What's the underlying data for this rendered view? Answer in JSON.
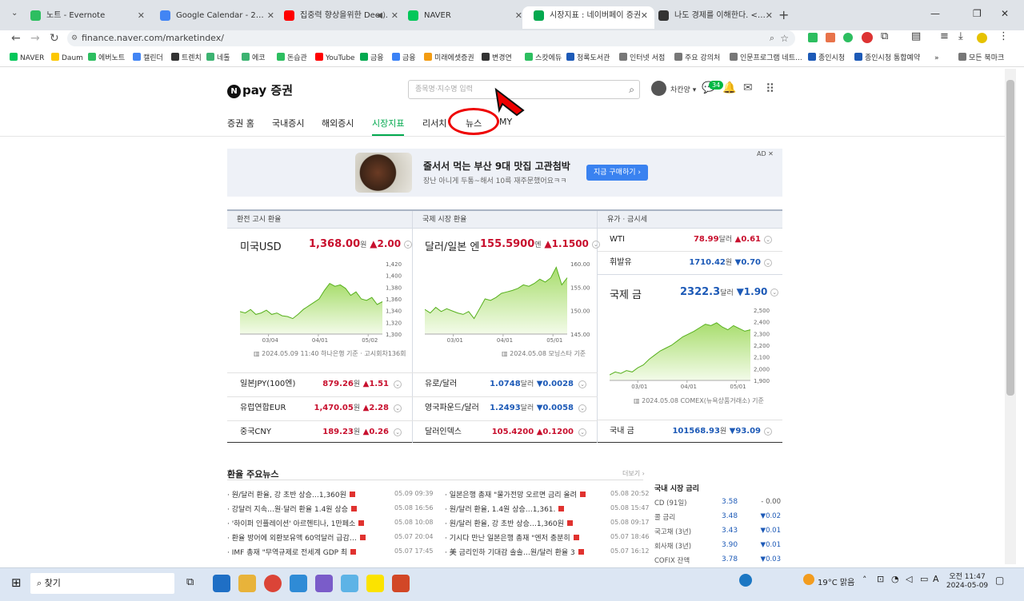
{
  "tabs": [
    {
      "label": "노트 - Evernote",
      "color": "#2dbe60"
    },
    {
      "label": "Google Calendar - 2024년 5월",
      "color": "#4285f4"
    },
    {
      "label": "집중력 향상을위한 Deep F",
      "color": "#ff0000"
    },
    {
      "label": "NAVER",
      "color": "#03c75a"
    },
    {
      "label": "시장지표 : 네이버페이 증권",
      "color": "#03a94f"
    },
    {
      "label": "나도 경제를 이해한다. <돈습관",
      "color": "#333333"
    }
  ],
  "address": {
    "url": "finance.naver.com/marketindex/"
  },
  "bookmarks": [
    "NAVER",
    "Daum",
    "에버노트",
    "캘린더",
    "트렌치",
    "네톨",
    "에코",
    "돈습관",
    "YouTube",
    "금융",
    "금융",
    "미래에셋증권",
    "변경연",
    "스캇에듀",
    "청록도서관",
    "인터넷 서점",
    "주요 강의처",
    "인문프로그램 네트...",
    "종인시청",
    "종인시청 통합예약",
    "모든 북마크"
  ],
  "header": {
    "logo_n": "N",
    "logo_text": "pay 증권",
    "search_placeholder": "종목명·지수명 입력",
    "user_name": "차칸양",
    "badge": "34"
  },
  "gnb": [
    "증권 홈",
    "국내증시",
    "해외증시",
    "시장지표",
    "리서치",
    "뉴스",
    "MY"
  ],
  "ad": {
    "title": "줄서서 먹는 부산 9대 맛집 고관첨박",
    "subtitle": "장난 아니게 두통~해서 10륵 재주문했어요ㅋㅋ",
    "button": "지금 구매하기 ›",
    "tag": "AD ✕"
  },
  "market": {
    "headers": [
      "환전 고시 환율",
      "국제 시장 환율",
      "유가 · 금시세"
    ],
    "usd": {
      "name": "미국USD",
      "value": "1,368.00",
      "unit": "원",
      "change": "▲2.00",
      "yticks": [
        "1,420",
        "1,400",
        "1,380",
        "1,360",
        "1,340",
        "1,320",
        "1,300"
      ],
      "xticks": [
        "03/04",
        "04/01",
        "05/02"
      ],
      "source": "2024.05.09 11:40 하나은행 기준 · 고시회차136회"
    },
    "jpy": {
      "name": "달러/일본 엔",
      "value": "155.5900",
      "unit": "엔",
      "change": "▲1.1500",
      "yticks": [
        "160.00",
        "155.00",
        "150.00",
        "145.00"
      ],
      "xticks": [
        "03/01",
        "04/01",
        "05/01"
      ],
      "source": "2024.05.08 모닝스타 기준"
    },
    "wti": {
      "name": "WTI",
      "value": "78.99",
      "unit": "달러",
      "change": "▲0.61"
    },
    "gasoline": {
      "name": "휘발유",
      "value": "1710.42",
      "unit": "원",
      "change": "▼0.70"
    },
    "gold": {
      "name": "국제 금",
      "value": "2322.3",
      "unit": "달러",
      "change": "▼1.90",
      "yticks": [
        "2,500",
        "2,400",
        "2,300",
        "2,200",
        "2,100",
        "2,000",
        "1,900"
      ],
      "xticks": [
        "03/01",
        "04/01",
        "05/01"
      ],
      "source": "2024.05.08 COMEX(뉴욕상품거래소) 기준"
    },
    "rows_left": [
      {
        "name": "일본JPY(100엔)",
        "value": "879.26",
        "unit": "원",
        "change": "▲1.51",
        "dir": "up"
      },
      {
        "name": "유럽연합EUR",
        "value": "1,470.05",
        "unit": "원",
        "change": "▲2.28",
        "dir": "up"
      },
      {
        "name": "중국CNY",
        "value": "189.23",
        "unit": "원",
        "change": "▲0.26",
        "dir": "up"
      }
    ],
    "rows_mid": [
      {
        "name": "유로/달러",
        "value": "1.0748",
        "unit": "달러",
        "change": "▼0.0028",
        "dir": "dn"
      },
      {
        "name": "영국파운드/달러",
        "value": "1.2493",
        "unit": "달러",
        "change": "▼0.0058",
        "dir": "dn"
      },
      {
        "name": "달러인덱스",
        "value": "105.4200",
        "unit": "",
        "change": "▲0.1200",
        "dir": "up"
      }
    ],
    "domestic_gold": {
      "name": "국내 금",
      "value": "101568.93",
      "unit": "원",
      "change": "▼93.09"
    }
  },
  "news": {
    "title": "환율 주요뉴스",
    "more": "더보기 ›",
    "left": [
      {
        "t": "원/달러 환율, 강 초반 상승…1,360원",
        "d": "05.09 09:39"
      },
      {
        "t": "강달러 지속…원·달러 환율 1.4원 상승",
        "d": "05.08 16:56"
      },
      {
        "t": "'하이퍼 인플레이션' 아르헨티나, 1만페소",
        "d": "05.08 10:08"
      },
      {
        "t": "환율 방어에 외환보유액 60억달러 급감…",
        "d": "05.07 20:04"
      },
      {
        "t": "IMF 총재 \"무역규제로 전세계 GDP 최",
        "d": "05.07 17:45"
      }
    ],
    "right": [
      {
        "t": "일본은행 총재 \"물가전망 오르면 금리 올려",
        "d": "05.08 20:52"
      },
      {
        "t": "원/달러 환율, 1.4원 상승…1,361.",
        "d": "05.08 15:47"
      },
      {
        "t": "원/달러 환율, 강 초반 상승…1,360원",
        "d": "05.08 09:17"
      },
      {
        "t": "기시다 만난 일본은행 총재 \"엔저 충분히",
        "d": "05.07 18:46"
      },
      {
        "t": "美 금리인하 기대감 솔솔…원/달러 환율 3",
        "d": "05.07 16:12"
      }
    ]
  },
  "rates": {
    "title": "국내 시장 금리",
    "items": [
      {
        "n": "CD (91일)",
        "v": "3.58",
        "c": "- 0.00",
        "dir": "flat"
      },
      {
        "n": "콜 금리",
        "v": "3.48",
        "c": "▼0.02",
        "dir": "dn"
      },
      {
        "n": "국고채 (3년)",
        "v": "3.43",
        "c": "▼0.01",
        "dir": "dn"
      },
      {
        "n": "회사채 (3년)",
        "v": "3.90",
        "c": "▼0.01",
        "dir": "dn"
      },
      {
        "n": "COFIX 잔액",
        "v": "3.78",
        "c": "▼0.03",
        "dir": "dn"
      }
    ]
  },
  "taskbar": {
    "search": "찾기",
    "weather": "19°C 맑음",
    "time": "오전 11:47",
    "date": "2024-05-09"
  }
}
